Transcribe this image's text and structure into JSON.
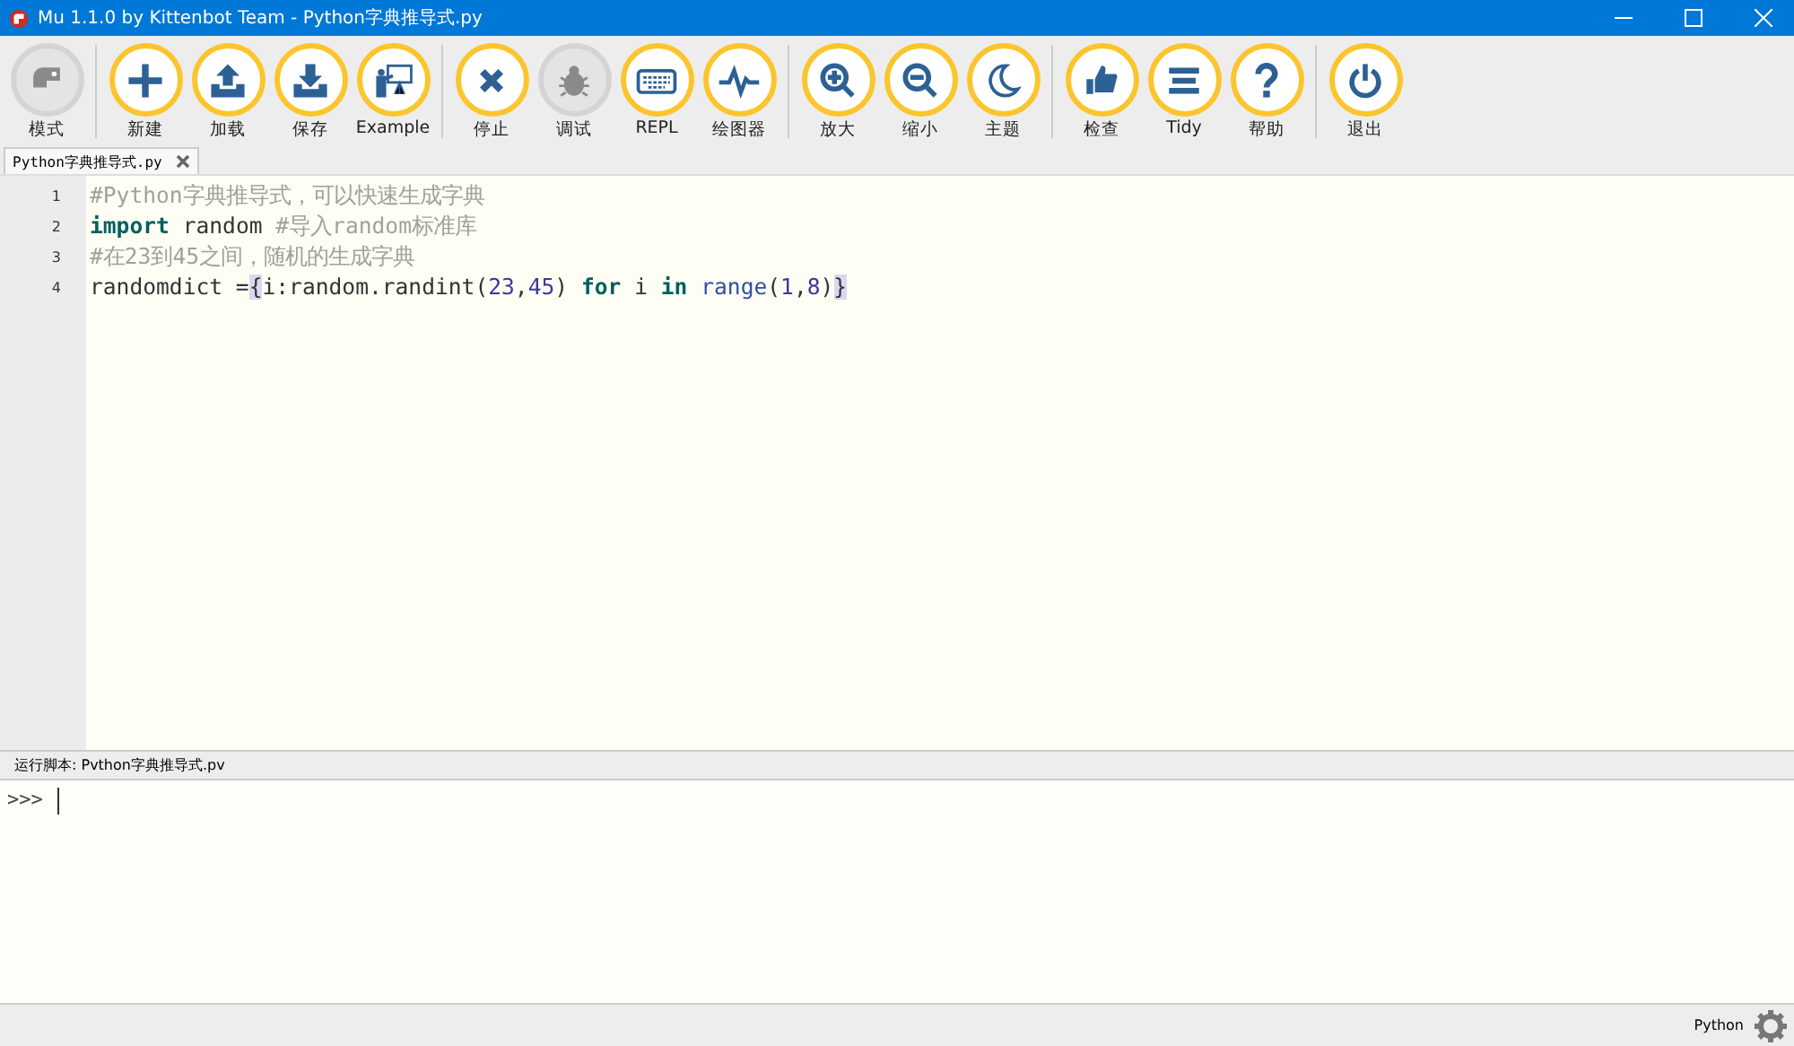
{
  "window": {
    "title": "Mu 1.1.0 by Kittenbot Team - Python字典推导式.py"
  },
  "toolbar": {
    "groups": [
      [
        {
          "label": "模式",
          "kind": "mode",
          "disabled": true
        }
      ],
      [
        {
          "label": "新建",
          "kind": "plus",
          "disabled": false
        },
        {
          "label": "加载",
          "kind": "upload",
          "disabled": false
        },
        {
          "label": "保存",
          "kind": "download",
          "disabled": false
        },
        {
          "label": "Example",
          "kind": "presenter",
          "disabled": false
        }
      ],
      [
        {
          "label": "停止",
          "kind": "cross",
          "disabled": false
        },
        {
          "label": "调试",
          "kind": "bug",
          "disabled": true
        },
        {
          "label": "REPL",
          "kind": "keyboard",
          "disabled": false
        },
        {
          "label": "绘图器",
          "kind": "pulse",
          "disabled": false
        }
      ],
      [
        {
          "label": "放大",
          "kind": "zoomin",
          "disabled": false
        },
        {
          "label": "缩小",
          "kind": "zoomout",
          "disabled": false
        },
        {
          "label": "主题",
          "kind": "moon",
          "disabled": false
        }
      ],
      [
        {
          "label": "检查",
          "kind": "thumb",
          "disabled": false
        },
        {
          "label": "Tidy",
          "kind": "lines",
          "disabled": false
        },
        {
          "label": "帮助",
          "kind": "question",
          "disabled": false
        }
      ],
      [
        {
          "label": "退出",
          "kind": "power",
          "disabled": false
        }
      ]
    ]
  },
  "tabs": [
    {
      "label": "Python字典推导式.py",
      "selected": true
    }
  ],
  "editor": {
    "lines": [
      {
        "number": "1",
        "tokens": [
          {
            "kind": "comment",
            "text": "#Python字典推导式，可以快速生成字典"
          }
        ]
      },
      {
        "number": "2",
        "tokens": [
          {
            "kind": "keyword",
            "text": "import"
          },
          {
            "kind": "plain",
            "text": " random "
          },
          {
            "kind": "comment",
            "text": "#导入random标准库"
          }
        ]
      },
      {
        "number": "3",
        "tokens": [
          {
            "kind": "comment",
            "text": "#在23到45之间，随机的生成字典"
          }
        ]
      },
      {
        "number": "4",
        "tokens": [
          {
            "kind": "plain",
            "text": "randomdict ="
          },
          {
            "kind": "brace",
            "text": "{"
          },
          {
            "kind": "plain",
            "text": "i:random.randint("
          },
          {
            "kind": "number",
            "text": "23"
          },
          {
            "kind": "plain",
            "text": ","
          },
          {
            "kind": "number",
            "text": "45"
          },
          {
            "kind": "plain",
            "text": ") "
          },
          {
            "kind": "keyword",
            "text": "for"
          },
          {
            "kind": "plain",
            "text": " i "
          },
          {
            "kind": "keyword",
            "text": "in"
          },
          {
            "kind": "builtin",
            "text": " range"
          },
          {
            "kind": "plain",
            "text": "("
          },
          {
            "kind": "number",
            "text": "1"
          },
          {
            "kind": "plain",
            "text": ","
          },
          {
            "kind": "number",
            "text": "8"
          },
          {
            "kind": "plain",
            "text": ")"
          },
          {
            "kind": "brace",
            "text": "}"
          }
        ]
      }
    ]
  },
  "repl": {
    "title": "运行脚本: Pvthon字典推导式.pv",
    "prompt": ">>>"
  },
  "status_bar": {
    "mode": "Python"
  }
}
